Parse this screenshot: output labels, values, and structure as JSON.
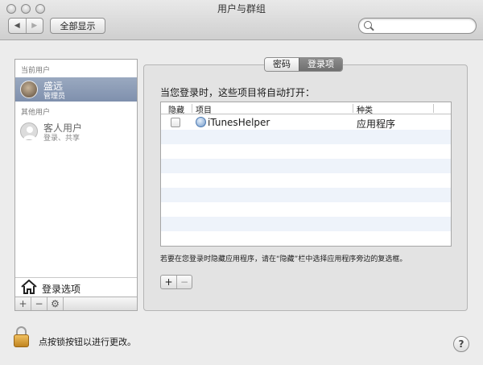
{
  "window": {
    "title": "用户与群组"
  },
  "toolbar": {
    "back": "◀",
    "forward": "▶",
    "show_all": "全部显示",
    "search_placeholder": ""
  },
  "sidebar": {
    "current_header": "当前用户",
    "current_user": {
      "name": "盛远",
      "role": "管理员"
    },
    "other_header": "其他用户",
    "guest_user": {
      "name": "客人用户",
      "status": "登录、共享"
    },
    "login_options": "登录选项",
    "buttons": {
      "add": "+",
      "remove": "−",
      "gear": "⚙"
    }
  },
  "tabs": [
    {
      "label": "密码",
      "selected": false
    },
    {
      "label": "登录项",
      "selected": true
    }
  ],
  "login_items": {
    "prompt": "当您登录时，这些项目将自动打开：",
    "columns": {
      "hide": "隐藏",
      "item": "项目",
      "kind": "种类"
    },
    "rows": [
      {
        "hidden": false,
        "name": "iTunesHelper",
        "kind": "应用程序"
      }
    ],
    "note": "若要在您登录时隐藏应用程序，请在“隐藏”栏中选择应用程序旁边的复选框。",
    "add": "+",
    "remove": "−"
  },
  "footer": {
    "lock_text": "点按锁按钮以进行更改。",
    "help": "?"
  },
  "colors": {
    "selection": "#8c9db8",
    "alt_row": "#eef3fa",
    "lock": "#d9a03a"
  }
}
